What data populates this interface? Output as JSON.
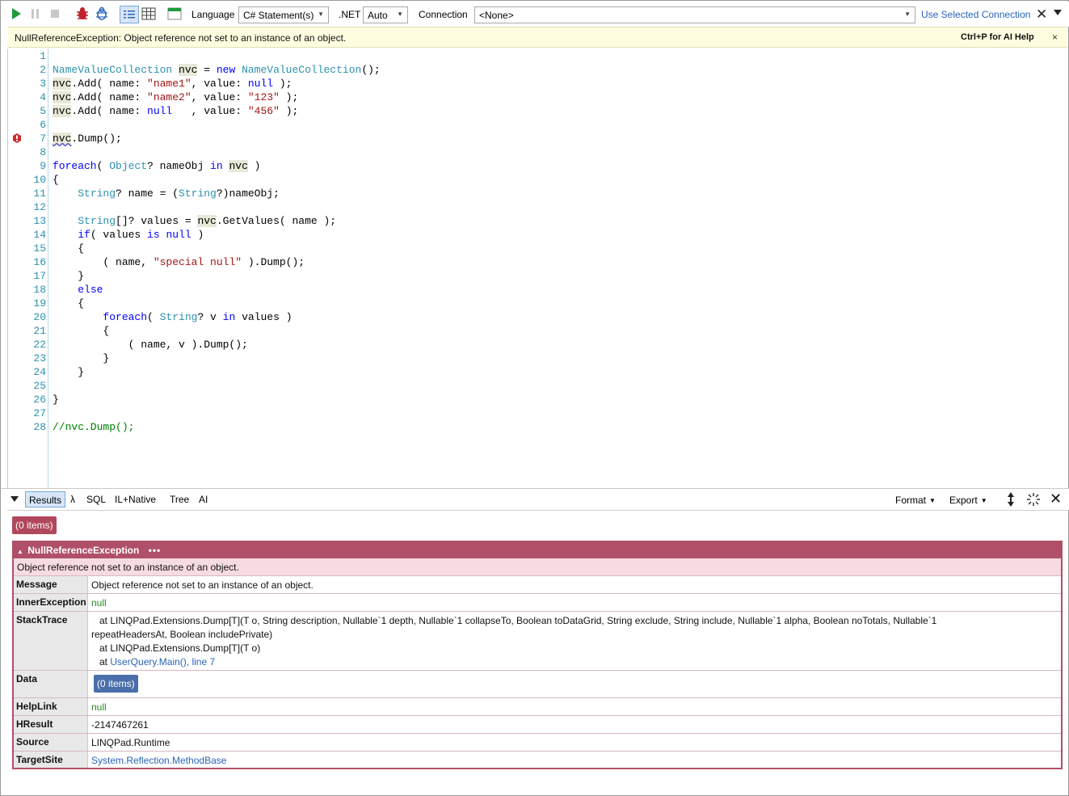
{
  "toolbar": {
    "language_label": "Language",
    "language_value": "C# Statement(s)",
    "net_label": ".NET",
    "net_value": "Auto",
    "connection_label": "Connection",
    "connection_value": "<None>",
    "use_selected_connection": "Use Selected Connection",
    "close": "✕"
  },
  "banner": {
    "message": "NullReferenceException: Object reference not set to an instance of an object.",
    "help": "Ctrl+P for AI Help",
    "close": "×"
  },
  "editor": {
    "line_numbers": [
      "1",
      "2",
      "3",
      "4",
      "5",
      "6",
      "7",
      "8",
      "9",
      "10",
      "11",
      "12",
      "13",
      "14",
      "15",
      "16",
      "17",
      "18",
      "19",
      "20",
      "21",
      "22",
      "23",
      "24",
      "25",
      "26",
      "27",
      "28"
    ],
    "code": {
      "l2a": "NameValueCollection",
      "l2b": "nvc",
      "l2c": " = ",
      "l2d": "new",
      "l2e": " ",
      "l2f": "NameValueCollection",
      "l2g": "();",
      "l3a": "nvc",
      "l3b": ".Add( name: ",
      "l3c": "\"name1\"",
      "l3d": ", value: ",
      "l3e": "null",
      "l3f": " );",
      "l4a": "nvc",
      "l4b": ".Add( name: ",
      "l4c": "\"name2\"",
      "l4d": ", value: ",
      "l4e": "\"123\"",
      "l4f": " );",
      "l5a": "nvc",
      "l5b": ".Add( name: ",
      "l5c": "null",
      "l5d": "   , value: ",
      "l5e": "\"456\"",
      "l5f": " );",
      "l7a": "nvc",
      "l7b": ".Dump();",
      "l9a": "foreach",
      "l9b": "( ",
      "l9c": "Object",
      "l9d": "? nameObj ",
      "l9e": "in",
      "l9f": " ",
      "l9g": "nvc",
      "l9h": " )",
      "l10": "{",
      "l11a": "    ",
      "l11b": "String",
      "l11c": "? name = (",
      "l11d": "String",
      "l11e": "?)nameObj;",
      "l13a": "    ",
      "l13b": "String",
      "l13c": "[]? values = ",
      "l13d": "nvc",
      "l13e": ".GetValues( name );",
      "l14a": "    ",
      "l14b": "if",
      "l14c": "( values ",
      "l14d": "is",
      "l14e": " ",
      "l14f": "null",
      "l14g": " )",
      "l15": "    {",
      "l16a": "        ( name, ",
      "l16b": "\"special null\"",
      "l16c": " ).Dump();",
      "l17": "    }",
      "l18a": "    ",
      "l18b": "else",
      "l19": "    {",
      "l20a": "        ",
      "l20b": "foreach",
      "l20c": "( ",
      "l20d": "String",
      "l20e": "? v ",
      "l20f": "in",
      "l20g": " values )",
      "l21": "        {",
      "l22": "            ( name, v ).Dump();",
      "l23": "        }",
      "l24": "    }",
      "l26": "}",
      "l28": "//nvc.Dump();"
    }
  },
  "results_toolbar": {
    "tabs": [
      "Results",
      "λ",
      "SQL",
      "IL+Native",
      "Tree",
      "AI"
    ],
    "format": "Format",
    "export": "Export"
  },
  "results": {
    "top_badge": "(0 items)",
    "exception_type": "NullReferenceException",
    "exception_more": "•••",
    "exception_summary": "Object reference not set to an instance of an object.",
    "rows": {
      "message_key": "Message",
      "message_val": "Object reference not set to an instance of an object.",
      "inner_key": "InnerException",
      "inner_val": "null",
      "stack_key": "StackTrace",
      "stack_line1": "at LINQPad.Extensions.Dump[T](T o, String description, Nullable`1 depth, Nullable`1 collapseTo, Boolean toDataGrid, String exclude, String include, Nullable`1 alpha, Boolean noTotals, Nullable`1",
      "stack_line1b": "repeatHeadersAt, Boolean includePrivate)",
      "stack_line2": "at LINQPad.Extensions.Dump[T](T o)",
      "stack_line3_prefix": "at ",
      "stack_line3_link": "UserQuery.Main(), line 7",
      "data_key": "Data",
      "data_badge": "(0 items)",
      "helplink_key": "HelpLink",
      "helplink_val": "null",
      "hresult_key": "HResult",
      "hresult_val": "-2147467261",
      "source_key": "Source",
      "source_val": "LINQPad.Runtime",
      "targetsite_key": "TargetSite",
      "targetsite_val": "System.Reflection.MethodBase"
    }
  }
}
